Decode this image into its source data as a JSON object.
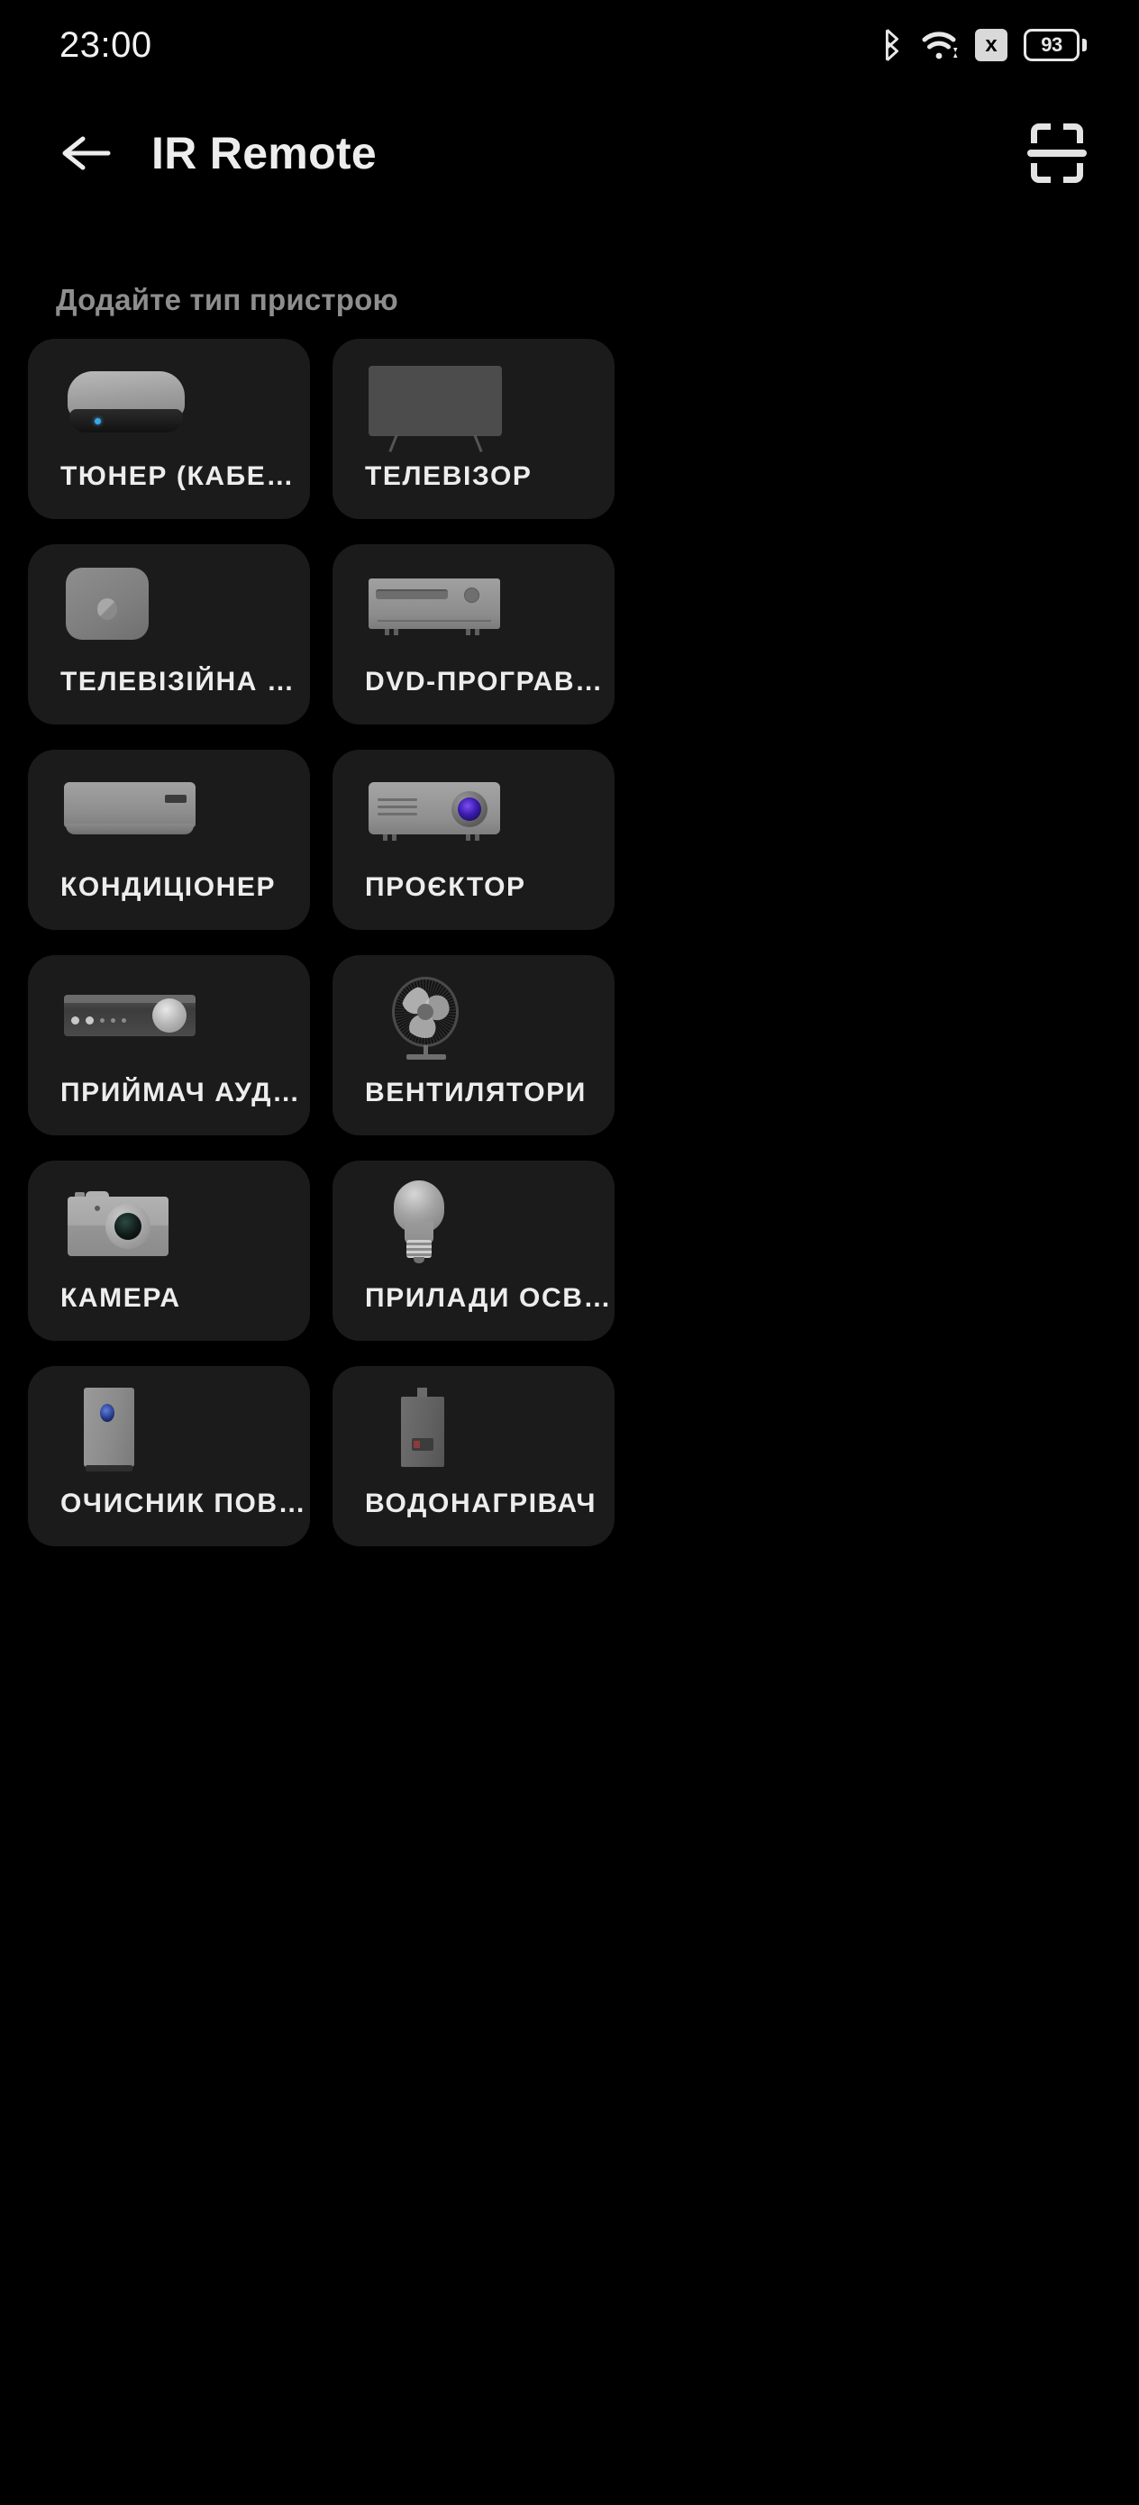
{
  "status_bar": {
    "time": "23:00",
    "battery_percent": "93",
    "icons": [
      "bluetooth-icon",
      "wifi-icon",
      "sim-disabled-icon",
      "battery-icon"
    ],
    "sim_badge": "x"
  },
  "app_bar": {
    "back_label": "back-arrow-icon",
    "title": "IR Remote",
    "action_label": "scan-icon"
  },
  "section": {
    "title": "Додайте тип пристрою"
  },
  "colors": {
    "background": "#000000",
    "card_background": "#1b1b1b",
    "primary_text": "#ededed",
    "secondary_text": "#8e8e8e",
    "tv_screen_accent": "#2f6ab0",
    "projector_lens_accent": "#3c1bb0",
    "led_accent": "#3aa7e8"
  },
  "devices": [
    {
      "label": "ТЮНЕР (КАБЕ…",
      "art": "set-top-box"
    },
    {
      "label": "ТЕЛЕВІЗОР",
      "art": "television"
    },
    {
      "label": "ТЕЛЕВІЗІЙНА …",
      "art": "tv-box"
    },
    {
      "label": "DVD-ПРОГРАВ…",
      "art": "dvd-player"
    },
    {
      "label": "КОНДИЦІОНЕР",
      "art": "air-conditioner"
    },
    {
      "label": "ПРОЄКТОР",
      "art": "projector"
    },
    {
      "label": "ПРИЙМАЧ АУД…",
      "art": "audio-receiver"
    },
    {
      "label": "ВЕНТИЛЯТОРИ",
      "art": "fan"
    },
    {
      "label": "КАМЕРА",
      "art": "camera"
    },
    {
      "label": "ПРИЛАДИ ОСВ…",
      "art": "light-bulb"
    },
    {
      "label": "ОЧИСНИК ПОВ…",
      "art": "air-purifier"
    },
    {
      "label": "ВОДОНАГРІВАЧ",
      "art": "water-heater"
    }
  ]
}
